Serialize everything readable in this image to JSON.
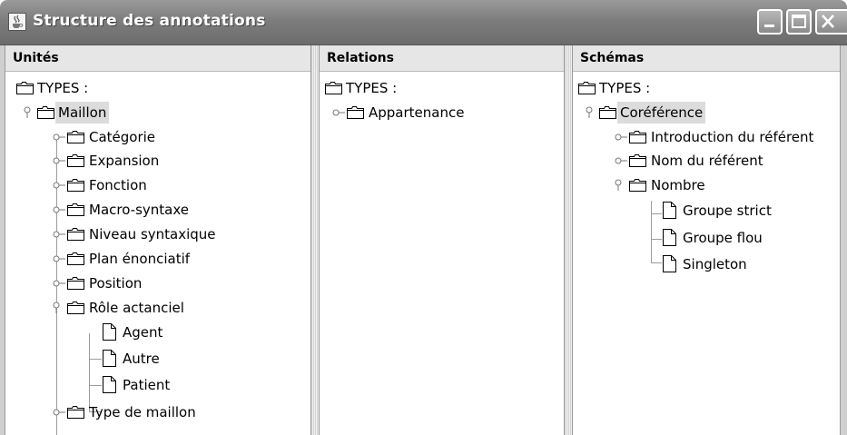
{
  "window": {
    "title": "Structure des annotations"
  },
  "panels": {
    "units": {
      "header": "Unités",
      "root": "TYPES :",
      "nodes": [
        {
          "label": "Maillon"
        },
        {
          "label": "Catégorie"
        },
        {
          "label": "Expansion"
        },
        {
          "label": "Fonction"
        },
        {
          "label": "Macro-syntaxe"
        },
        {
          "label": "Niveau syntaxique"
        },
        {
          "label": "Plan énonciatif"
        },
        {
          "label": "Position"
        },
        {
          "label": "Rôle actanciel"
        },
        {
          "label": "Agent"
        },
        {
          "label": "Autre"
        },
        {
          "label": "Patient"
        },
        {
          "label": "Type de maillon"
        }
      ]
    },
    "relations": {
      "header": "Relations",
      "root": "TYPES :",
      "nodes": [
        {
          "label": "Appartenance"
        }
      ]
    },
    "schemas": {
      "header": "Schémas",
      "root": "TYPES :",
      "nodes": [
        {
          "label": "Coréférence"
        },
        {
          "label": "Introduction du référent"
        },
        {
          "label": "Nom du référent"
        },
        {
          "label": "Nombre"
        },
        {
          "label": "Groupe strict"
        },
        {
          "label": "Groupe flou"
        },
        {
          "label": "Singleton"
        }
      ]
    }
  },
  "icons": {
    "folder": "folder-icon",
    "leaf": "file-icon",
    "expanded_handle": "expanded-handle-icon",
    "collapsed_handle": "collapsed-handle-icon",
    "window_icon": "java-cup-icon",
    "minimize": "minimize-icon",
    "maximize": "maximize-icon",
    "close": "close-icon"
  },
  "colors": {
    "titlebar": "#7d7d7d",
    "selection": "#dcdcdc",
    "panel_header": "#e6e6e6"
  }
}
